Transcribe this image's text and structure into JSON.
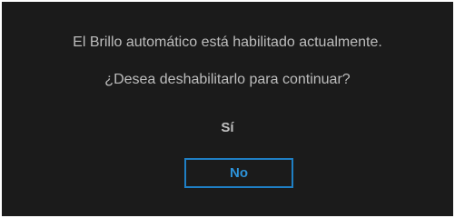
{
  "dialog": {
    "message_line1": "El Brillo automático está habilitado actualmente.",
    "message_line2": "¿Desea deshabilitarlo para continuar?",
    "options": {
      "yes_label": "Sí",
      "no_label": "No",
      "selected": "No"
    }
  },
  "colors": {
    "background": "#1b1b1b",
    "text": "#bdbdbd",
    "accent": "#1f7fc4"
  }
}
